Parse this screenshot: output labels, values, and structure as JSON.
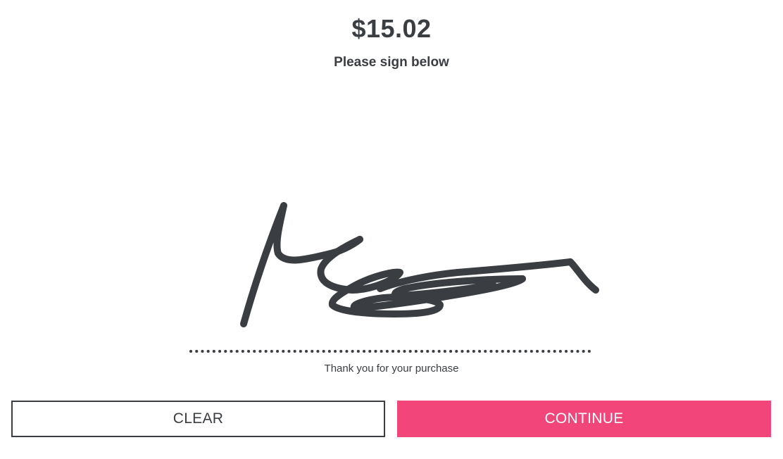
{
  "payment": {
    "amount": "$15.02",
    "instruction": "Please sign below",
    "thank_you": "Thank you for your purchase"
  },
  "actions": {
    "clear_label": "CLEAR",
    "continue_label": "CONTINUE"
  },
  "colors": {
    "text": "#3a3e42",
    "accent": "#f2457a",
    "ink": "#3a3e42"
  }
}
